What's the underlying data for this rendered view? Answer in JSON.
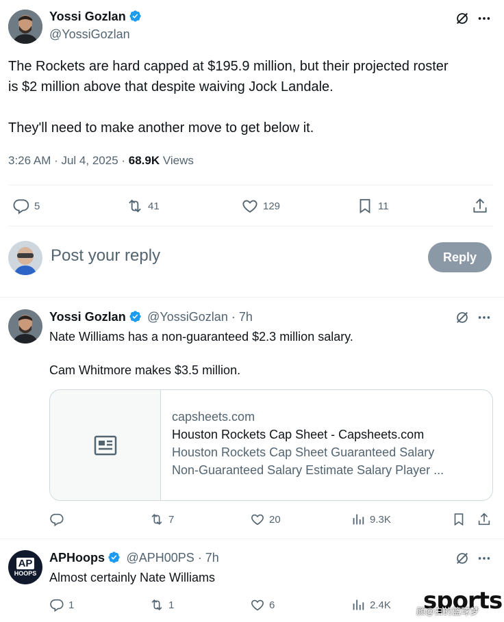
{
  "main_tweet": {
    "author_name": "Yossi Gozlan",
    "author_handle": "@YossiGozlan",
    "text_line1": "The Rockets are hard capped at $195.9 million, but their projected roster",
    "text_line2": "is $2 million above that despite waiving Jock Landale.",
    "text_line3": "They'll need to make another move to get below it.",
    "time": "3:26 AM · Jul 4, 2025 · ",
    "views_count": "68.9K",
    "views_label": " Views",
    "replies": "5",
    "reposts": "41",
    "likes": "129",
    "bookmarks": "11"
  },
  "reply_box": {
    "placeholder": "Post your reply",
    "button_label": "Reply"
  },
  "reply1": {
    "author_name": "Yossi Gozlan",
    "author_handle": "@YossiGozlan",
    "time": " · 7h",
    "text_line1": "Nate Williams has a non-guaranteed $2.3 million salary.",
    "text_line2": "Cam Whitmore makes $3.5 million.",
    "card_domain": "capsheets.com",
    "card_title": "Houston Rockets Cap Sheet - Capsheets.com",
    "card_desc1": "Houston Rockets Cap Sheet Guaranteed Salary",
    "card_desc2": "Non-Guaranteed Salary Estimate Salary Player ...",
    "replies": "",
    "reposts": "7",
    "likes": "20",
    "views": "9.3K"
  },
  "reply2": {
    "author_name": "APHoops",
    "author_handle": "@APH00PS",
    "time": " · 7h",
    "avatar_text_top": "AP",
    "avatar_text_bottom": "HOOPS",
    "text_line1": "Almost certainly Nate Williams",
    "replies": "1",
    "reposts": "1",
    "likes": "6",
    "views": "2.4K"
  },
  "watermark": {
    "brand": "sports",
    "caption": "颜@白的篮球梦"
  },
  "colors": {
    "verified_blue": "#1d9bf0",
    "secondary_text": "#536471",
    "reply_button": "#8b98a5"
  }
}
